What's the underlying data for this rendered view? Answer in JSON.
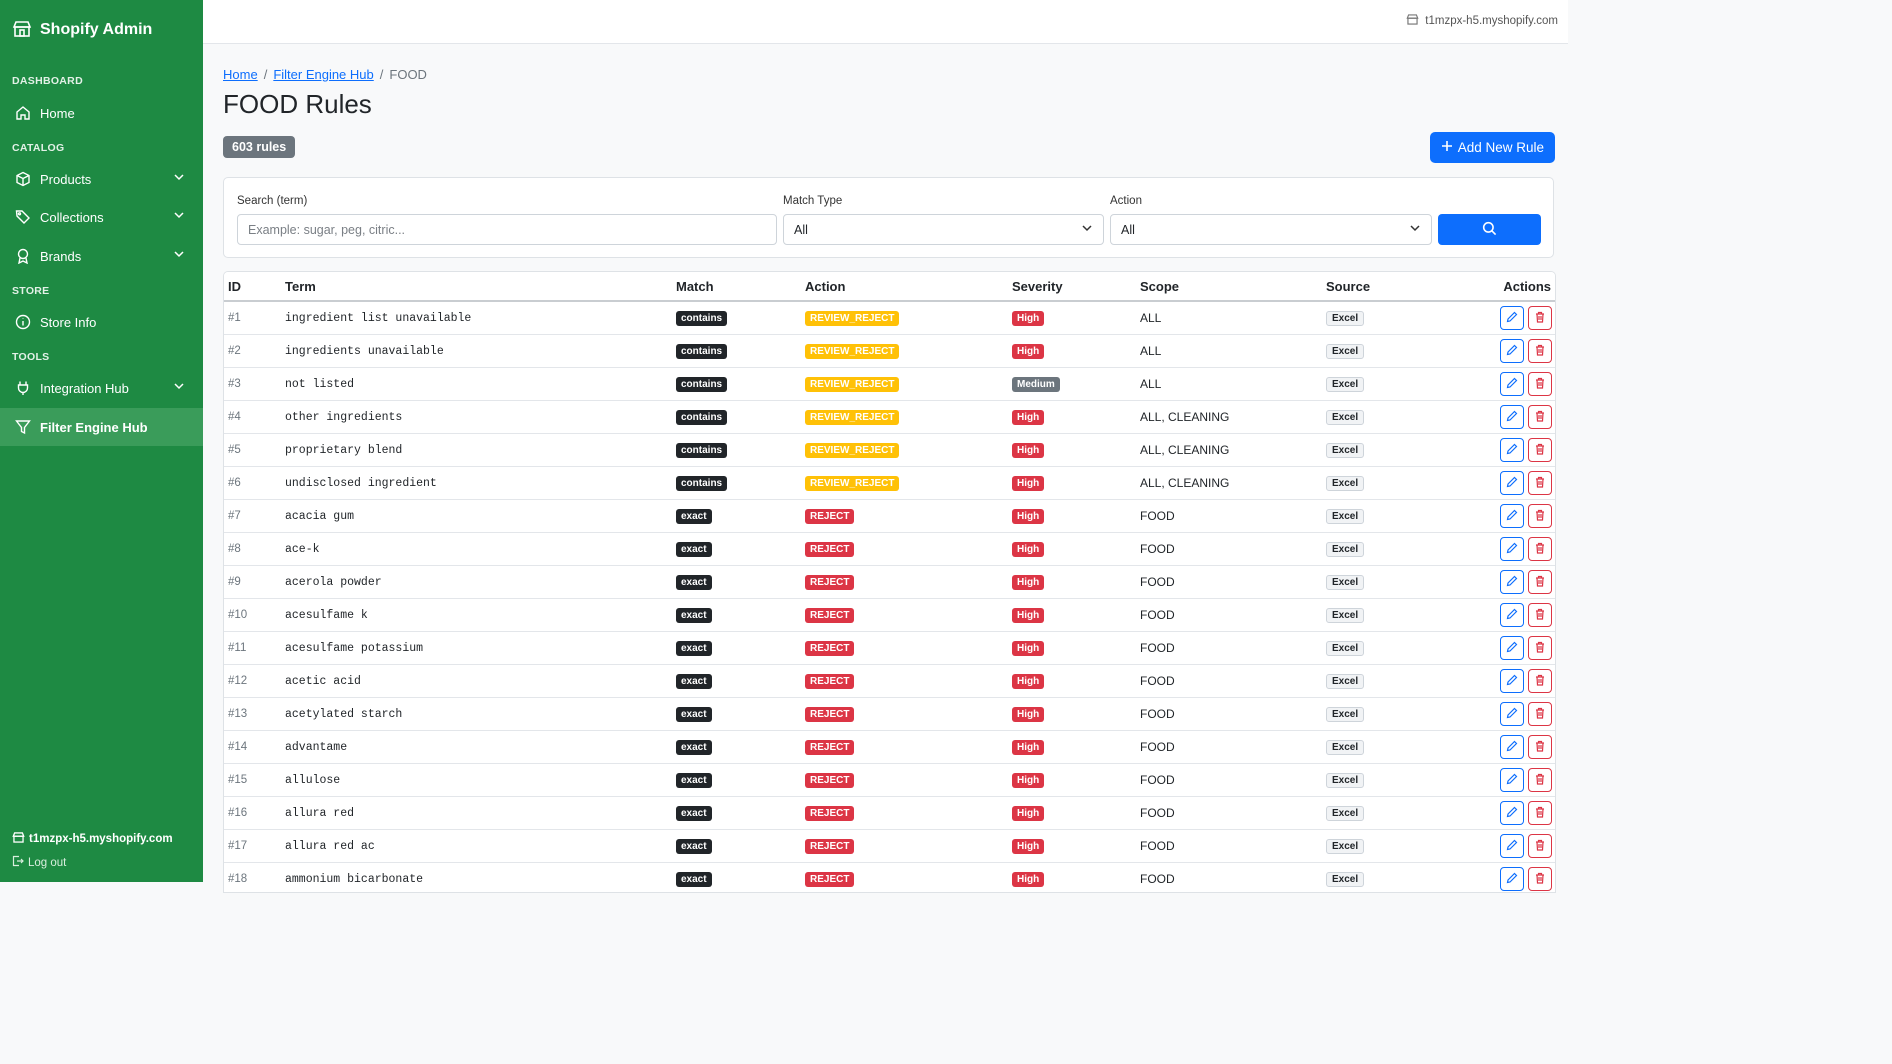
{
  "sidebar": {
    "brand": "Shopify Admin",
    "sections": {
      "dashboard": "DASHBOARD",
      "catalog": "CATALOG",
      "store": "STORE",
      "tools": "TOOLS"
    },
    "items": {
      "home": "Home",
      "products": "Products",
      "collections": "Collections",
      "brands": "Brands",
      "store_info": "Store Info",
      "integration_hub": "Integration Hub",
      "filter_engine_hub": "Filter Engine Hub"
    },
    "footer_store": "t1mzpx-h5.myshopify.com",
    "logout": "Log out"
  },
  "topbar": {
    "store": "t1mzpx-h5.myshopify.com"
  },
  "breadcrumb": {
    "home": "Home",
    "hub": "Filter Engine Hub",
    "current": "FOOD"
  },
  "page": {
    "title": "FOOD Rules",
    "count": "603 rules",
    "add_button": "Add New Rule"
  },
  "filters": {
    "search_label": "Search (term)",
    "search_placeholder": "Example: sugar, peg, citric...",
    "match_label": "Match Type",
    "match_value": "All",
    "action_label": "Action",
    "action_value": "All"
  },
  "table": {
    "headers": {
      "id": "ID",
      "term": "Term",
      "match": "Match",
      "action": "Action",
      "severity": "Severity",
      "scope": "Scope",
      "source": "Source",
      "actions": "Actions"
    },
    "rows": [
      {
        "id": "#1",
        "term": "ingredient list unavailable",
        "match": "contains",
        "action": "REVIEW_REJECT",
        "severity": "High",
        "scope": "ALL",
        "source": "Excel"
      },
      {
        "id": "#2",
        "term": "ingredients unavailable",
        "match": "contains",
        "action": "REVIEW_REJECT",
        "severity": "High",
        "scope": "ALL",
        "source": "Excel"
      },
      {
        "id": "#3",
        "term": "not listed",
        "match": "contains",
        "action": "REVIEW_REJECT",
        "severity": "Medium",
        "scope": "ALL",
        "source": "Excel"
      },
      {
        "id": "#4",
        "term": "other ingredients",
        "match": "contains",
        "action": "REVIEW_REJECT",
        "severity": "High",
        "scope": "ALL, CLEANING",
        "source": "Excel"
      },
      {
        "id": "#5",
        "term": "proprietary blend",
        "match": "contains",
        "action": "REVIEW_REJECT",
        "severity": "High",
        "scope": "ALL, CLEANING",
        "source": "Excel"
      },
      {
        "id": "#6",
        "term": "undisclosed ingredient",
        "match": "contains",
        "action": "REVIEW_REJECT",
        "severity": "High",
        "scope": "ALL, CLEANING",
        "source": "Excel"
      },
      {
        "id": "#7",
        "term": "acacia gum",
        "match": "exact",
        "action": "REJECT",
        "severity": "High",
        "scope": "FOOD",
        "source": "Excel"
      },
      {
        "id": "#8",
        "term": "ace-k",
        "match": "exact",
        "action": "REJECT",
        "severity": "High",
        "scope": "FOOD",
        "source": "Excel"
      },
      {
        "id": "#9",
        "term": "acerola powder",
        "match": "exact",
        "action": "REJECT",
        "severity": "High",
        "scope": "FOOD",
        "source": "Excel"
      },
      {
        "id": "#10",
        "term": "acesulfame k",
        "match": "exact",
        "action": "REJECT",
        "severity": "High",
        "scope": "FOOD",
        "source": "Excel"
      },
      {
        "id": "#11",
        "term": "acesulfame potassium",
        "match": "exact",
        "action": "REJECT",
        "severity": "High",
        "scope": "FOOD",
        "source": "Excel"
      },
      {
        "id": "#12",
        "term": "acetic acid",
        "match": "exact",
        "action": "REJECT",
        "severity": "High",
        "scope": "FOOD",
        "source": "Excel"
      },
      {
        "id": "#13",
        "term": "acetylated starch",
        "match": "exact",
        "action": "REJECT",
        "severity": "High",
        "scope": "FOOD",
        "source": "Excel"
      },
      {
        "id": "#14",
        "term": "advantame",
        "match": "exact",
        "action": "REJECT",
        "severity": "High",
        "scope": "FOOD",
        "source": "Excel"
      },
      {
        "id": "#15",
        "term": "allulose",
        "match": "exact",
        "action": "REJECT",
        "severity": "High",
        "scope": "FOOD",
        "source": "Excel"
      },
      {
        "id": "#16",
        "term": "allura red",
        "match": "exact",
        "action": "REJECT",
        "severity": "High",
        "scope": "FOOD",
        "source": "Excel"
      },
      {
        "id": "#17",
        "term": "allura red ac",
        "match": "exact",
        "action": "REJECT",
        "severity": "High",
        "scope": "FOOD",
        "source": "Excel"
      },
      {
        "id": "#18",
        "term": "ammonium bicarbonate",
        "match": "exact",
        "action": "REJECT",
        "severity": "High",
        "scope": "FOOD",
        "source": "Excel"
      }
    ]
  },
  "colors": {
    "sidebar": "#1e8a43",
    "active": "#3a9c5a",
    "primary": "#0d6efd",
    "danger": "#dc3545",
    "warning": "#ffc107"
  }
}
